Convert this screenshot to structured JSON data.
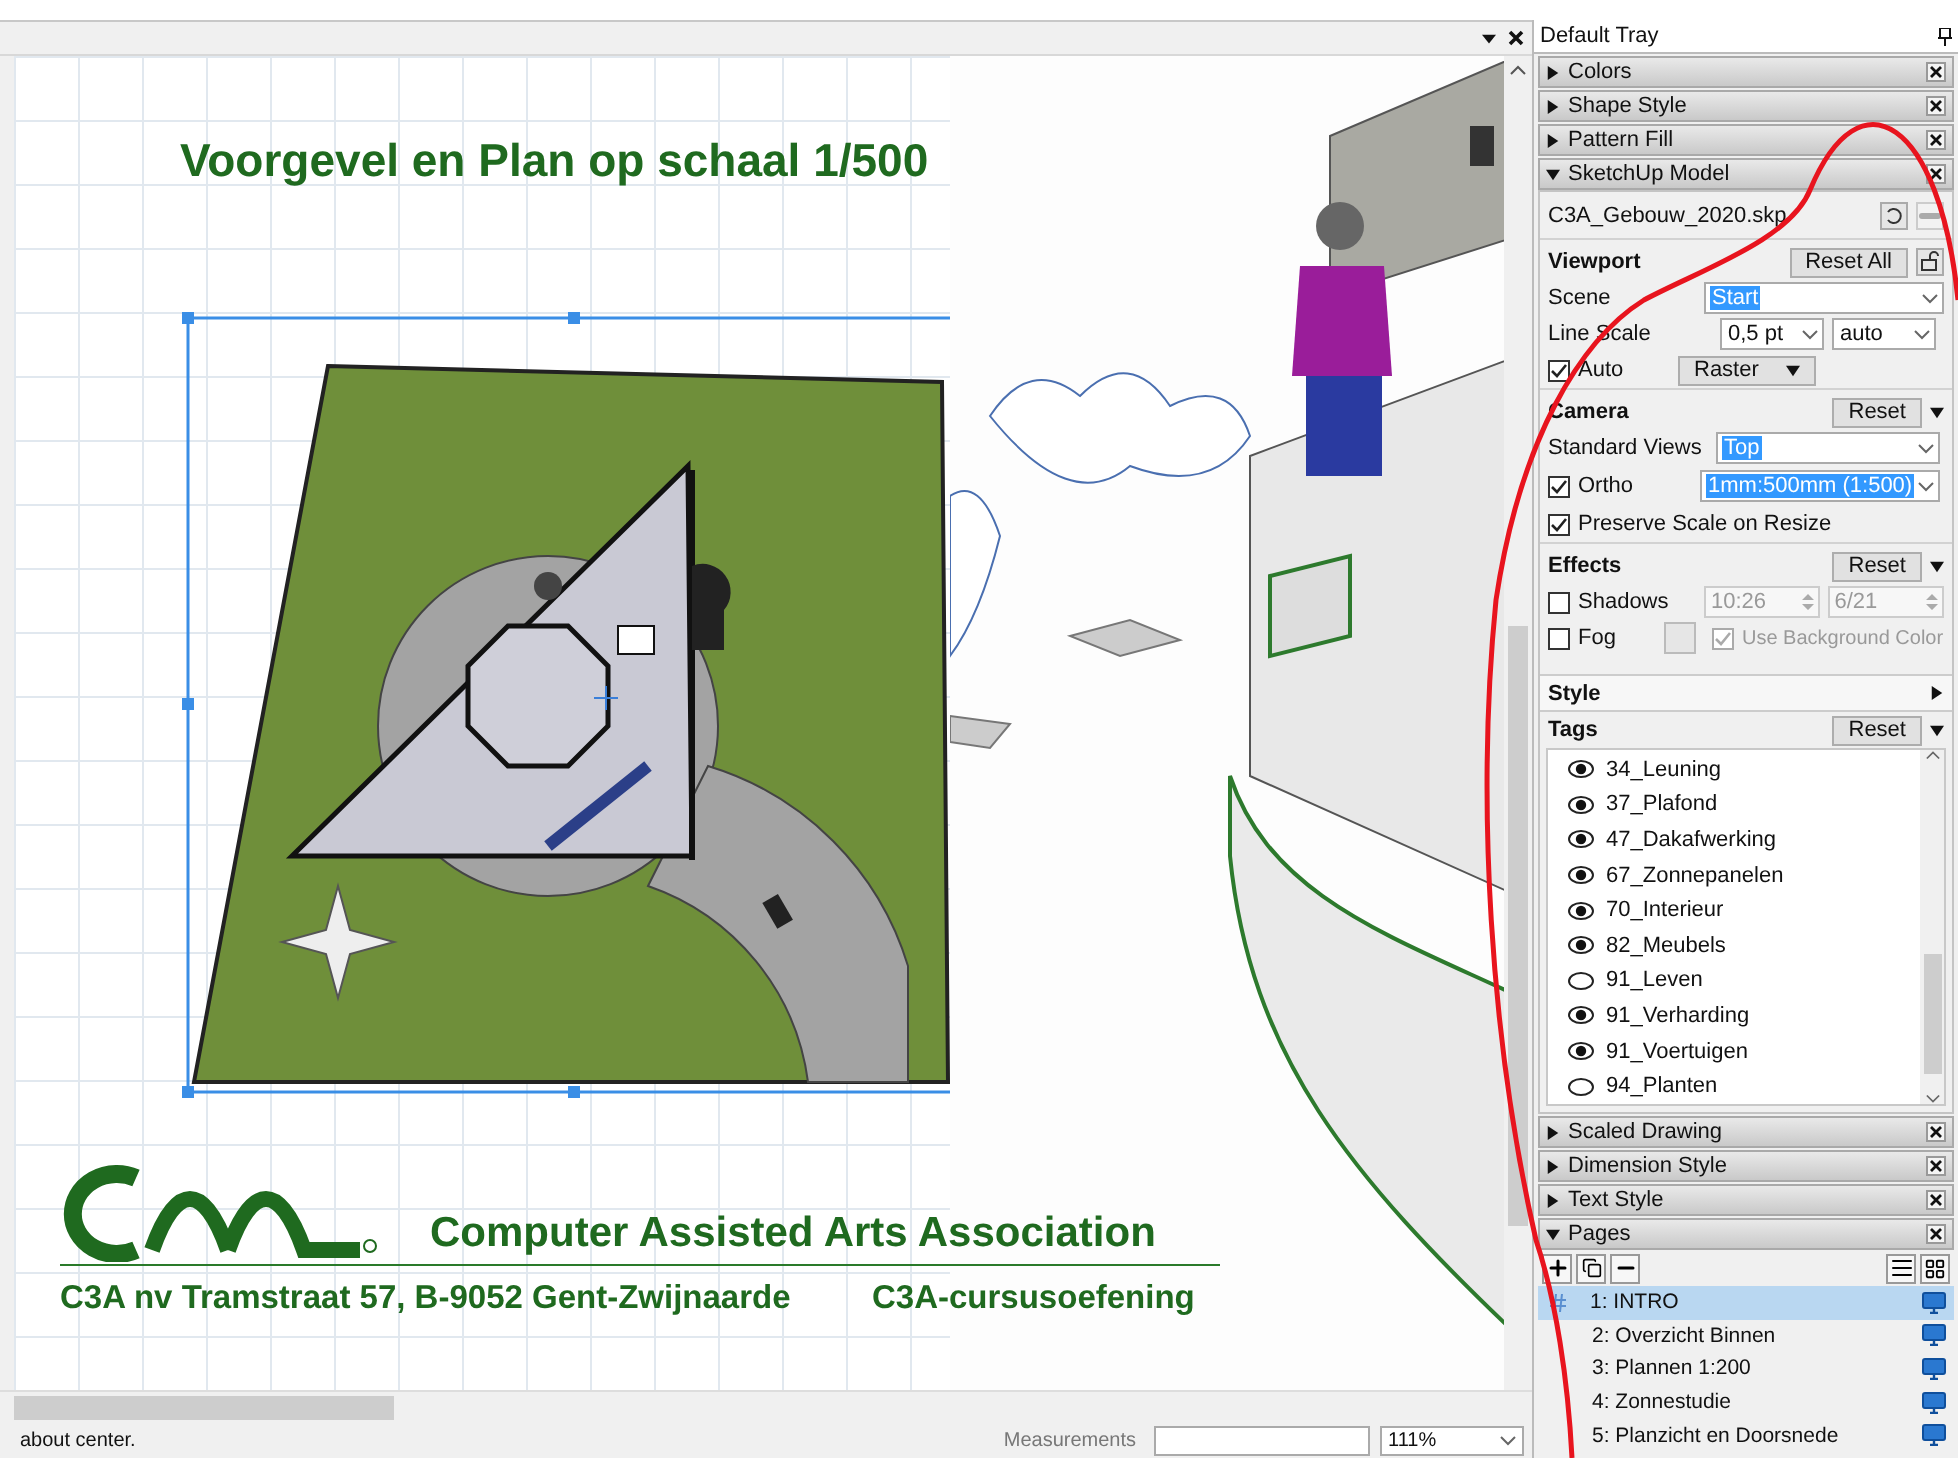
{
  "canvas": {
    "heading": "Voorgevel en Plan op schaal 1/500",
    "company_name": "Computer Assisted Arts Association",
    "address": "C3A nv  Tramstraat 57, B-9052 Gent-Zwijnaarde",
    "course": "C3A-cursusoefening"
  },
  "status_bar": {
    "message": "about center.",
    "measurements_label": "Measurements",
    "zoom": "111%"
  },
  "tray": {
    "title": "Default Tray",
    "panels": [
      {
        "title": "Colors",
        "expanded": false
      },
      {
        "title": "Shape Style",
        "expanded": false
      },
      {
        "title": "Pattern Fill",
        "expanded": false
      },
      {
        "title": "SketchUp Model",
        "kind": "model",
        "expanded": true
      },
      {
        "title": "Scaled Drawing",
        "expanded": false
      },
      {
        "title": "Dimension Style",
        "expanded": false
      },
      {
        "title": "Text Style",
        "expanded": false
      },
      {
        "title": "Pages",
        "kind": "pages",
        "expanded": true
      }
    ],
    "model": {
      "file": "C3A_Gebouw_2020.skp",
      "viewport": {
        "label": "Viewport",
        "reset": "Reset All",
        "scene_label": "Scene",
        "scene": "Start",
        "line_scale_label": "Line Scale",
        "line_scale": "0,5 pt",
        "line_scale_mode": "auto",
        "auto_label": "Auto",
        "auto_checked": true,
        "render_mode": "Raster"
      },
      "camera": {
        "label": "Camera",
        "reset": "Reset",
        "expanded": true,
        "standard_views_label": "Standard Views",
        "standard_view": "Top",
        "ortho_label": "Ortho",
        "ortho_checked": true,
        "scale": "1mm:500mm (1:500)",
        "preserve_label": "Preserve Scale on Resize",
        "preserve_checked": true
      },
      "effects": {
        "label": "Effects",
        "reset": "Reset",
        "expanded": true,
        "shadows_label": "Shadows",
        "shadows_checked": false,
        "time": "10:26",
        "date": "6/21",
        "fog_label": "Fog",
        "fog_checked": false,
        "use_bg_label": "Use Background Color",
        "use_bg_checked": true
      },
      "style": {
        "label": "Style",
        "expanded": false
      },
      "tags": {
        "label": "Tags",
        "reset": "Reset",
        "expanded": true,
        "items": [
          {
            "name": "34_Leuning",
            "visible": true
          },
          {
            "name": "37_Plafond",
            "visible": true
          },
          {
            "name": "47_Dakafwerking",
            "visible": true
          },
          {
            "name": "67_Zonnepanelen",
            "visible": true
          },
          {
            "name": "70_Interieur",
            "visible": true
          },
          {
            "name": "82_Meubels",
            "visible": true
          },
          {
            "name": "91_Leven",
            "visible": false
          },
          {
            "name": "91_Verharding",
            "visible": true
          },
          {
            "name": "91_Voertuigen",
            "visible": true
          },
          {
            "name": "94_Planten",
            "visible": false
          }
        ]
      }
    },
    "pages": {
      "items": [
        {
          "label": "1: INTRO",
          "selected": true
        },
        {
          "label": "2: Overzicht Binnen",
          "selected": false
        },
        {
          "label": "3: Plannen 1:200",
          "selected": false
        },
        {
          "label": "4: Zonnestudie",
          "selected": false
        },
        {
          "label": "5: Planzicht en Doorsnede",
          "selected": false
        }
      ]
    }
  }
}
